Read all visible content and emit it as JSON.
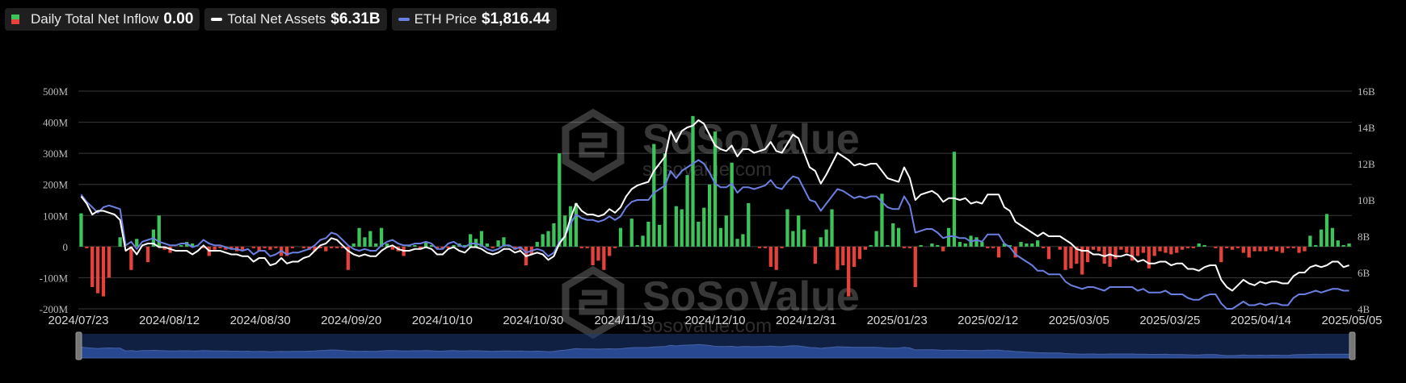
{
  "legend": {
    "inflow": {
      "label": "Daily Total Net Inflow",
      "value": "0.00"
    },
    "assets": {
      "label": "Total Net Assets",
      "value": "$6.31B"
    },
    "price": {
      "label": "ETH Price",
      "value": "$1,816.44"
    }
  },
  "watermark": {
    "brand": "SoSoValue",
    "site": "sosovalue.com"
  },
  "colors": {
    "inflow_positive": "#3cc45a",
    "inflow_negative": "#e6423b",
    "assets_line": "#ffffff",
    "price_line": "#6b7fe0",
    "navigator_fill": "#1d3a78"
  },
  "chart_data": {
    "type": "bar",
    "x_tick_labels": [
      "2024/07/23",
      "2024/08/12",
      "2024/08/30",
      "2024/09/20",
      "2024/10/10",
      "2024/10/30",
      "2024/11/19",
      "2024/12/10",
      "2024/12/31",
      "2025/01/23",
      "2025/02/12",
      "2025/03/05",
      "2025/03/25",
      "2025/04/14",
      "2025/05/05"
    ],
    "y_left_tick_labels": [
      "500M",
      "400M",
      "300M",
      "200M",
      "100M",
      "0",
      "-100M",
      "-200M"
    ],
    "y_right_tick_labels": [
      "16B",
      "14B",
      "12B",
      "10B",
      "8B",
      "6B",
      "4B"
    ],
    "ylim_left": [
      -200,
      500
    ],
    "ylim_right": [
      4,
      16
    ],
    "left_unit": "M",
    "right_unit": "B",
    "grid": true,
    "series": [
      {
        "name": "Daily Total Net Inflow",
        "kind": "bar",
        "axis": "left",
        "values": [
          107,
          -5,
          -130,
          -150,
          -160,
          -100,
          0,
          30,
          0,
          -75,
          25,
          0,
          -50,
          55,
          100,
          -10,
          -20,
          0,
          5,
          15,
          10,
          0,
          -5,
          -30,
          -10,
          -5,
          -10,
          -5,
          -15,
          -10,
          0,
          -5,
          -15,
          -5,
          -10,
          -5,
          -30,
          -30,
          -5,
          0,
          -5,
          -10,
          -15,
          -5,
          -15,
          -5,
          -5,
          -5,
          -75,
          10,
          60,
          30,
          50,
          10,
          60,
          10,
          -10,
          -15,
          -30,
          5,
          5,
          -10,
          15,
          5,
          -5,
          -5,
          -5,
          5,
          10,
          5,
          40,
          25,
          50,
          10,
          -5,
          20,
          30,
          5,
          -10,
          -10,
          -60,
          -25,
          15,
          40,
          50,
          75,
          300,
          100,
          130,
          140,
          -5,
          -5,
          -60,
          -45,
          -75,
          -30,
          -5,
          60,
          0,
          90,
          5,
          35,
          80,
          330,
          70,
          300,
          0,
          130,
          120,
          230,
          420,
          80,
          125,
          200,
          370,
          60,
          100,
          270,
          25,
          40,
          140,
          0,
          -5,
          -5,
          -65,
          -75,
          -5,
          120,
          50,
          100,
          55,
          0,
          -55,
          30,
          55,
          120,
          -75,
          -60,
          -160,
          -65,
          -40,
          -10,
          5,
          50,
          170,
          5,
          75,
          60,
          -5,
          -5,
          -130,
          5,
          0,
          10,
          5,
          -15,
          60,
          305,
          15,
          10,
          35,
          30,
          15,
          -5,
          -5,
          -35,
          10,
          5,
          -35,
          15,
          10,
          10,
          20,
          -5,
          -40,
          0,
          -10,
          -75,
          -70,
          -55,
          -90,
          -50,
          -10,
          -15,
          -55,
          -65,
          -40,
          -10,
          -20,
          -45,
          -30,
          -20,
          -70,
          -30,
          -15,
          -20,
          -25,
          -20,
          -10,
          -5,
          -5,
          10,
          5,
          0,
          -5,
          -50,
          -5,
          -10,
          -5,
          -20,
          -35,
          -15,
          -15,
          -15,
          -10,
          -15,
          -20,
          -5,
          -5,
          -20,
          -15,
          35,
          5,
          55,
          105,
          60,
          20,
          5,
          10
        ]
      },
      {
        "name": "Total Net Assets",
        "kind": "line",
        "axis": "right",
        "values": [
          10.2,
          9.8,
          9.2,
          9.4,
          9.4,
          9.3,
          9.2,
          8.9,
          7.2,
          7.4,
          7.0,
          7.5,
          7.6,
          7.6,
          7.4,
          7.4,
          7.3,
          7.2,
          7.2,
          7.2,
          7.0,
          7.2,
          7.5,
          7.2,
          7.2,
          7.2,
          7.1,
          7.0,
          7.0,
          6.9,
          6.9,
          6.6,
          6.8,
          6.8,
          6.4,
          6.5,
          6.8,
          6.5,
          6.6,
          6.6,
          6.8,
          6.9,
          7.2,
          7.5,
          7.6,
          7.9,
          7.8,
          7.5,
          7.2,
          7.0,
          6.9,
          7.0,
          6.9,
          6.9,
          7.2,
          7.4,
          7.5,
          7.3,
          7.2,
          7.2,
          7.3,
          7.3,
          7.4,
          7.3,
          7.0,
          7.0,
          7.3,
          7.4,
          7.2,
          7.1,
          7.4,
          7.4,
          7.3,
          7.1,
          7.0,
          7.1,
          7.3,
          7.3,
          7.1,
          7.2,
          6.9,
          7.0,
          7.1,
          7.0,
          6.7,
          6.9,
          7.6,
          8.0,
          9.0,
          9.8,
          9.4,
          9.2,
          9.2,
          9.1,
          9.2,
          9.5,
          9.3,
          9.6,
          10.2,
          10.6,
          10.8,
          10.9,
          11.0,
          11.6,
          12.0,
          12.4,
          13.8,
          13.2,
          13.8,
          14.0,
          14.1,
          14.4,
          14.2,
          13.6,
          13.0,
          12.8,
          12.7,
          13.0,
          12.4,
          12.8,
          12.8,
          12.6,
          12.7,
          12.8,
          13.2,
          12.7,
          12.6,
          13.1,
          13.6,
          13.4,
          12.6,
          11.8,
          11.6,
          10.9,
          11.4,
          12.0,
          12.6,
          12.4,
          12.2,
          11.9,
          12.0,
          11.9,
          12.0,
          12.0,
          11.6,
          11.2,
          11.1,
          11.0,
          11.8,
          11.2,
          10.0,
          10.3,
          10.4,
          10.5,
          10.3,
          9.9,
          10.1,
          10.1,
          10.0,
          10.1,
          9.8,
          9.9,
          9.8,
          10.3,
          10.3,
          10.3,
          9.6,
          9.4,
          8.8,
          8.6,
          8.4,
          8.2,
          8.0,
          8.2,
          8.0,
          8.0,
          8.0,
          7.8,
          7.6,
          7.3,
          7.2,
          7.2,
          7.0,
          7.0,
          6.9,
          7.0,
          6.9,
          6.9,
          7.0,
          6.9,
          6.6,
          6.7,
          6.5,
          6.5,
          6.6,
          6.6,
          6.4,
          6.5,
          6.5,
          6.2,
          6.2,
          6.1,
          6.3,
          6.4,
          6.4,
          5.6,
          5.2,
          5.0,
          5.3,
          5.6,
          5.4,
          5.3,
          5.5,
          5.4,
          5.5,
          5.5,
          5.4,
          5.4,
          5.8,
          6.0,
          6.0,
          6.3,
          6.4,
          6.3,
          6.4,
          6.6,
          6.6,
          6.3,
          6.4
        ]
      },
      {
        "name": "ETH Price",
        "kind": "line",
        "axis": "right",
        "values": [
          10.3,
          9.9,
          9.6,
          9.3,
          9.6,
          9.7,
          9.6,
          9.5,
          7.5,
          7.7,
          7.3,
          7.7,
          7.8,
          7.9,
          7.7,
          7.6,
          7.5,
          7.5,
          7.6,
          7.6,
          7.4,
          7.5,
          7.8,
          7.6,
          7.5,
          7.5,
          7.4,
          7.3,
          7.3,
          7.2,
          7.3,
          7.0,
          7.2,
          7.2,
          6.9,
          7.0,
          7.2,
          7.0,
          7.1,
          7.1,
          7.2,
          7.3,
          7.5,
          7.8,
          7.9,
          8.2,
          8.1,
          7.8,
          7.5,
          7.3,
          7.2,
          7.3,
          7.2,
          7.2,
          7.5,
          7.7,
          7.8,
          7.6,
          7.5,
          7.5,
          7.6,
          7.6,
          7.7,
          7.6,
          7.3,
          7.3,
          7.6,
          7.7,
          7.5,
          7.4,
          7.6,
          7.6,
          7.5,
          7.3,
          7.2,
          7.3,
          7.5,
          7.5,
          7.3,
          7.4,
          7.1,
          7.2,
          7.3,
          7.2,
          6.9,
          7.1,
          7.7,
          8.0,
          8.7,
          9.2,
          9.0,
          8.9,
          8.9,
          8.8,
          8.9,
          9.1,
          8.9,
          9.1,
          9.6,
          9.9,
          10.0,
          10.0,
          10.0,
          10.4,
          10.6,
          10.8,
          11.6,
          11.2,
          11.6,
          11.8,
          12.0,
          12.2,
          12.0,
          11.5,
          10.9,
          10.7,
          10.7,
          10.9,
          10.4,
          10.7,
          10.7,
          10.6,
          10.7,
          10.8,
          11.1,
          10.7,
          10.6,
          11.0,
          11.3,
          11.2,
          10.6,
          10.0,
          9.9,
          9.4,
          9.8,
          10.2,
          10.6,
          10.5,
          10.3,
          10.1,
          10.2,
          10.1,
          10.2,
          10.2,
          9.9,
          9.6,
          9.5,
          9.5,
          10.2,
          9.7,
          8.2,
          8.3,
          8.4,
          8.4,
          8.2,
          7.9,
          8.0,
          8.0,
          7.9,
          7.9,
          7.7,
          7.8,
          7.7,
          8.1,
          8.1,
          8.1,
          7.6,
          7.4,
          7.0,
          6.8,
          6.6,
          6.4,
          6.1,
          6.1,
          5.9,
          5.9,
          5.9,
          5.5,
          5.3,
          5.2,
          5.1,
          5.2,
          5.2,
          5.1,
          5.0,
          5.2,
          5.2,
          5.2,
          5.2,
          5.2,
          5.0,
          5.1,
          4.9,
          4.9,
          4.9,
          5.0,
          4.8,
          4.8,
          4.8,
          4.6,
          4.5,
          4.5,
          4.7,
          4.8,
          4.8,
          4.3,
          4.0,
          4.0,
          4.2,
          4.4,
          4.2,
          4.2,
          4.3,
          4.2,
          4.3,
          4.3,
          4.2,
          4.2,
          4.6,
          4.8,
          4.8,
          4.9,
          5.0,
          4.9,
          5.0,
          5.1,
          5.1,
          5.0,
          5.0
        ]
      }
    ]
  }
}
